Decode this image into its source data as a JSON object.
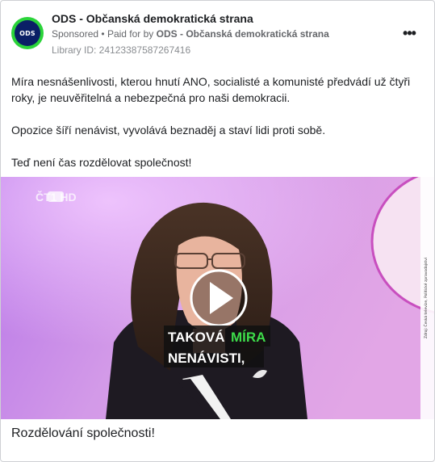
{
  "header": {
    "page_name": "ODS - Občanská demokratická strana",
    "avatar_text": "ODS",
    "sponsored_label": "Sponsored",
    "paid_for_prefix": "Paid for by",
    "paid_for_name": "ODS - Občanská demokratická strana",
    "library_id": "Library ID: 24123387587267416",
    "more_icon": "more-options-icon"
  },
  "post": {
    "paragraphs": [
      "Míra nesnášenlivosti, kterou hnutí ANO, socialisté a komunisté předvádí už čtyři roky, je neuvěřitelná a nebezpečná pro naši demokracii.",
      "Opozice šíří nenávist, vyvolává beznaděj a staví lidi proti sobě.",
      "Teď není čas rozdělovat společnost!"
    ]
  },
  "video": {
    "channel_logo": "ČT1 HD",
    "subtitle_line1_white": "TAKOVÁ",
    "subtitle_line1_green": "MÍRA",
    "subtitle_line2": "NENÁVISTI,",
    "side_credit": "Zdroj: Česká televize, Politické zpravodajství",
    "play_icon": "play-icon"
  },
  "caption": "Rozdělování společnosti!",
  "colors": {
    "avatar_ring": "#2bd43a",
    "avatar_bg": "#0a1f66",
    "subtitle_green": "#3ddc4a",
    "video_bg": "#cc8fe0"
  }
}
